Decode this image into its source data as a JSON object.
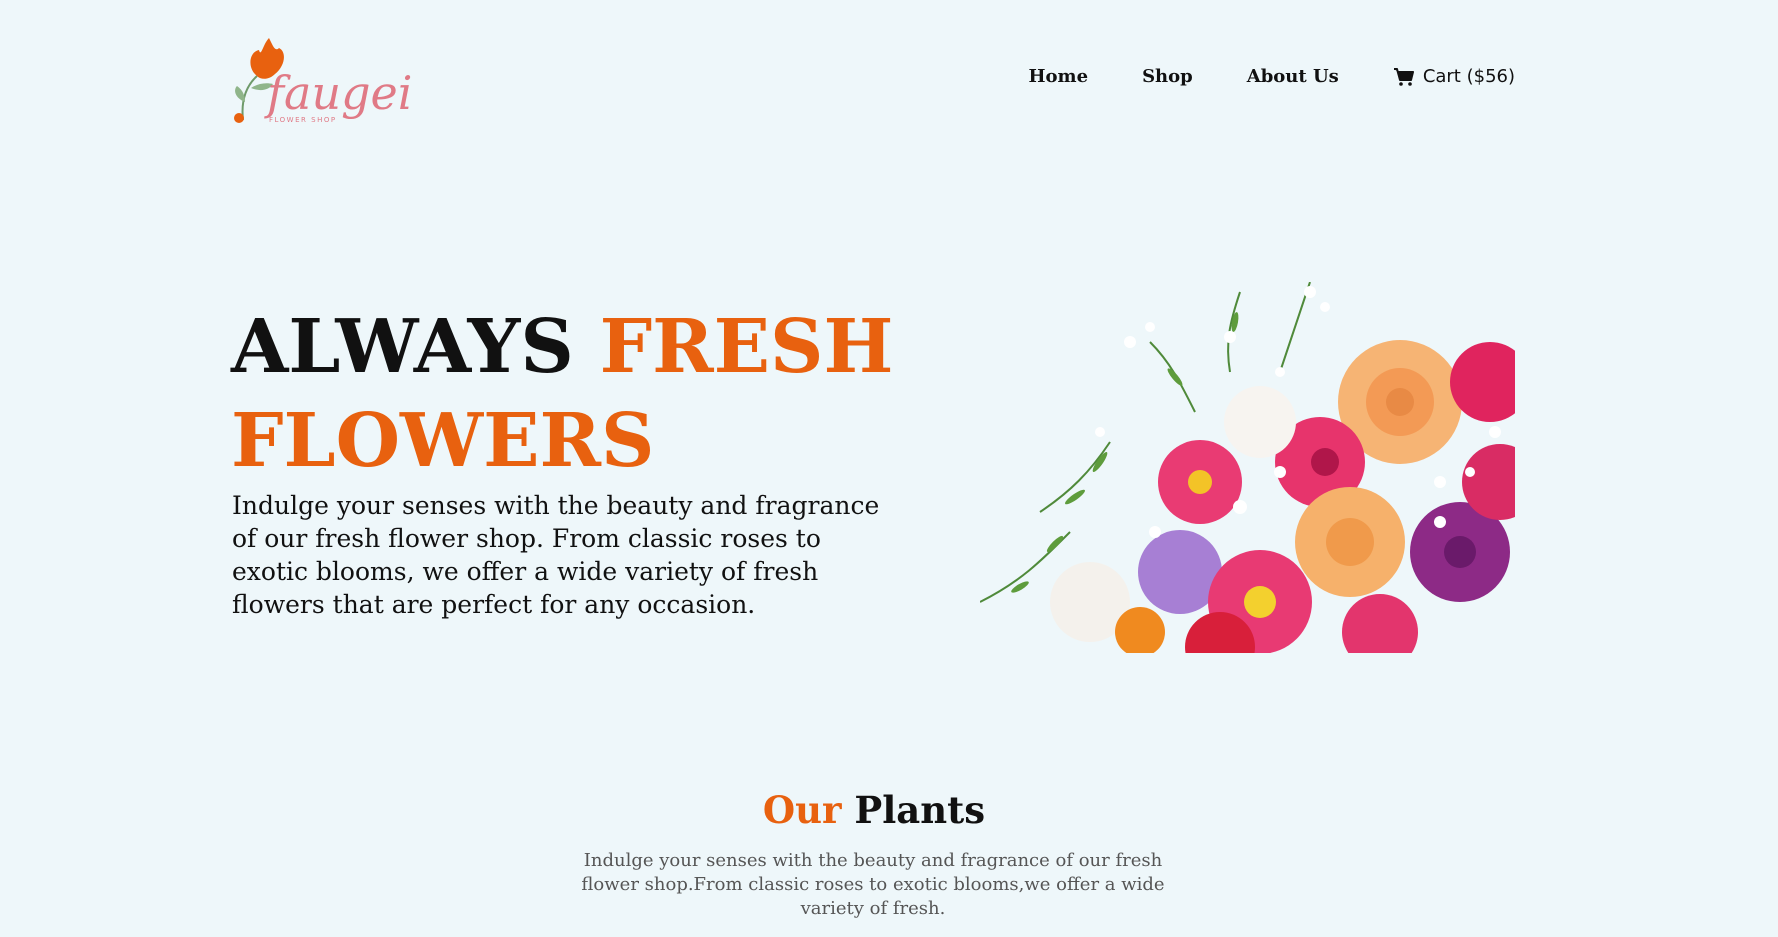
{
  "header": {
    "logo": {
      "brand": "faugei",
      "tagline": "FLOWER SHOP"
    },
    "nav": [
      {
        "label": "Home"
      },
      {
        "label": "Shop"
      },
      {
        "label": "About Us"
      }
    ],
    "cart": {
      "label": "Cart ($56)",
      "icon": "cart-icon"
    }
  },
  "hero": {
    "title_part1": "ALWAYS ",
    "title_part2": "FRESH FLOWERS",
    "description": "Indulge your senses with the beauty and fragrance of our fresh flower shop. From classic roses to exotic blooms, we offer a wide variety of fresh flowers that are perfect for any occasion."
  },
  "plants_section": {
    "title_accent": "Our",
    "title_rest": " Plants",
    "description": "Indulge your senses with the beauty and fragrance of our fresh flower shop.From classic roses to exotic blooms,we offer a wide variety of fresh."
  },
  "colors": {
    "background": "#eef7fa",
    "accent": "#e8610f",
    "logo": "#e07a86"
  }
}
